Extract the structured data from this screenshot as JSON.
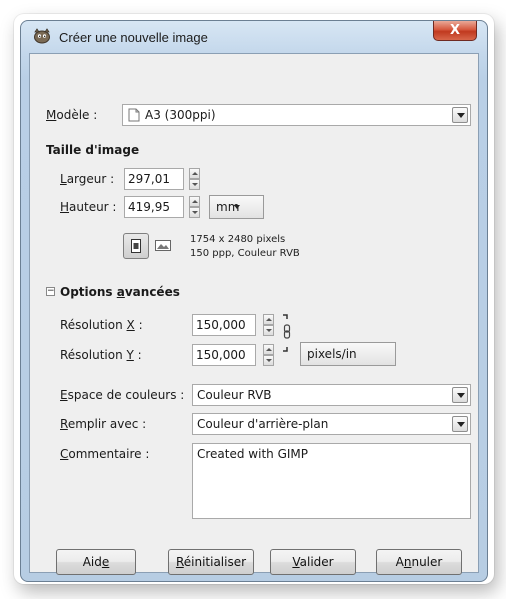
{
  "window": {
    "title": "Créer une nouvelle image",
    "close_label": "X"
  },
  "template": {
    "label_prefix": "M",
    "label_rest": "odèle :",
    "value": "A3 (300ppi)"
  },
  "image_size": {
    "heading": "Taille d'image",
    "width_label_u": "L",
    "width_label_rest": "argeur :",
    "width_value": "297,01",
    "height_label_u": "H",
    "height_label_rest": "auteur :",
    "height_value": "419,95",
    "unit": "mm",
    "info_line1": "1754 x 2480 pixels",
    "info_line2": "150 ppp, Couleur RVB"
  },
  "advanced": {
    "heading_pre": "Options ",
    "heading_u": "a",
    "heading_rest": "vancées",
    "toggle_symbol": "−",
    "res_x_label_pre": "Résolution ",
    "res_x_label_u": "X",
    "res_x_label_post": " :",
    "res_x_value": "150,000",
    "res_y_label_pre": "Résolution ",
    "res_y_label_u": "Y",
    "res_y_label_post": " :",
    "res_y_value": "150,000",
    "res_unit": "pixels/in",
    "colorspace_label_u": "E",
    "colorspace_label_rest": "space de couleurs :",
    "colorspace_value": "Couleur RVB",
    "fill_label_u": "R",
    "fill_label_rest": "emplir avec :",
    "fill_value": "Couleur d'arrière-plan",
    "comment_label_u": "C",
    "comment_label_rest": "ommentaire :",
    "comment_value": "Created with GIMP"
  },
  "buttons": {
    "help_pre": "Aid",
    "help_u": "e",
    "help_post": "",
    "reset_pre": "",
    "reset_u": "R",
    "reset_post": "éinitialiser",
    "ok_pre": "",
    "ok_u": "V",
    "ok_post": "alider",
    "cancel_pre": "A",
    "cancel_u": "n",
    "cancel_post": "nuler"
  },
  "colors": {
    "titlebar": "#c3d7eb",
    "close": "#c0391f",
    "dialog_bg": "#efefef"
  }
}
